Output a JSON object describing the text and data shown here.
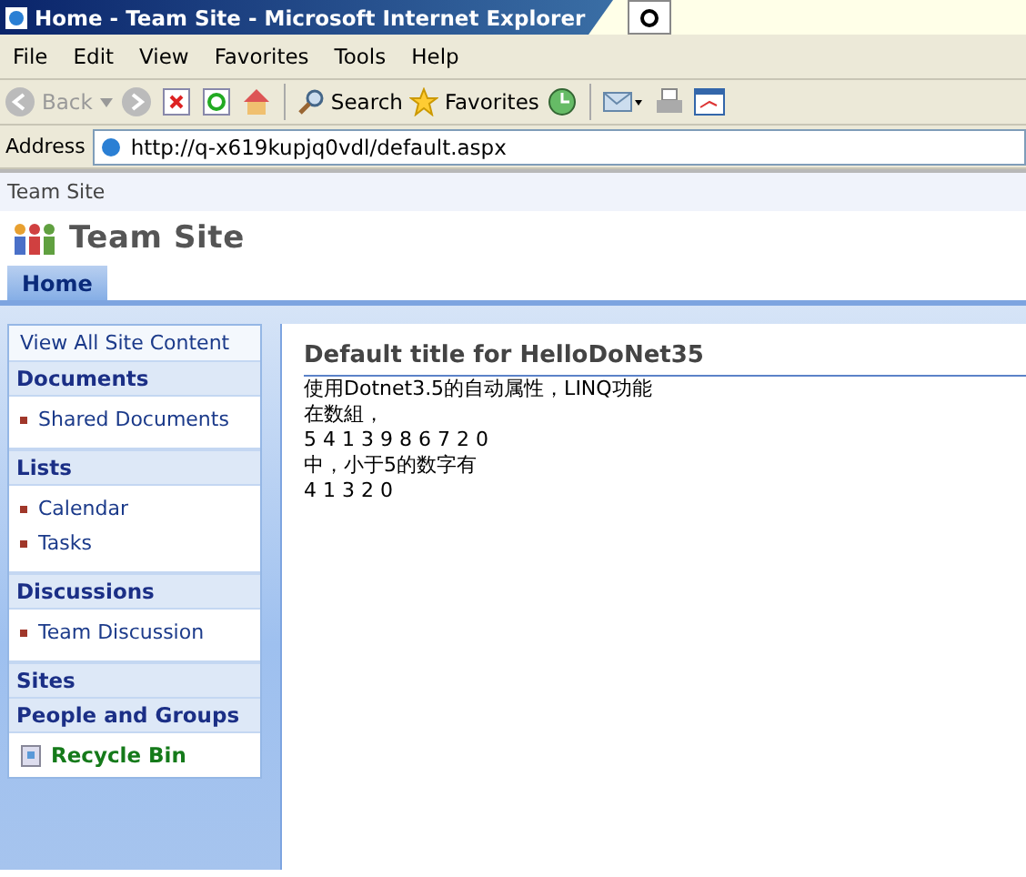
{
  "window": {
    "title": "Home - Team Site - Microsoft Internet Explorer"
  },
  "menu": [
    "File",
    "Edit",
    "View",
    "Favorites",
    "Tools",
    "Help"
  ],
  "toolbar": {
    "back": "Back",
    "search": "Search",
    "favorites": "Favorites"
  },
  "address": {
    "label": "Address",
    "value": "http://q-x619kupjq0vdl/default.aspx"
  },
  "breadcrumb": "Team Site",
  "site_title": "Team Site",
  "tabs": [
    {
      "label": "Home",
      "selected": true
    }
  ],
  "sidebar": {
    "view_all": "View All Site Content",
    "sections": [
      {
        "heading": "Documents",
        "items": [
          "Shared Documents"
        ]
      },
      {
        "heading": "Lists",
        "items": [
          "Calendar",
          "Tasks"
        ]
      },
      {
        "heading": "Discussions",
        "items": [
          "Team Discussion"
        ]
      },
      {
        "heading": "Sites"
      },
      {
        "heading": "People and Groups"
      }
    ],
    "recycle_bin": "Recycle Bin"
  },
  "content": {
    "title": "Default title for HelloDoNet35",
    "lines": [
      "使用Dotnet3.5的自动属性，LINQ功能",
      "在数組，",
      "5 4 1 3 9 8 6 7 2 0",
      "中，小于5的数字有",
      "4 1 3 2 0"
    ]
  }
}
